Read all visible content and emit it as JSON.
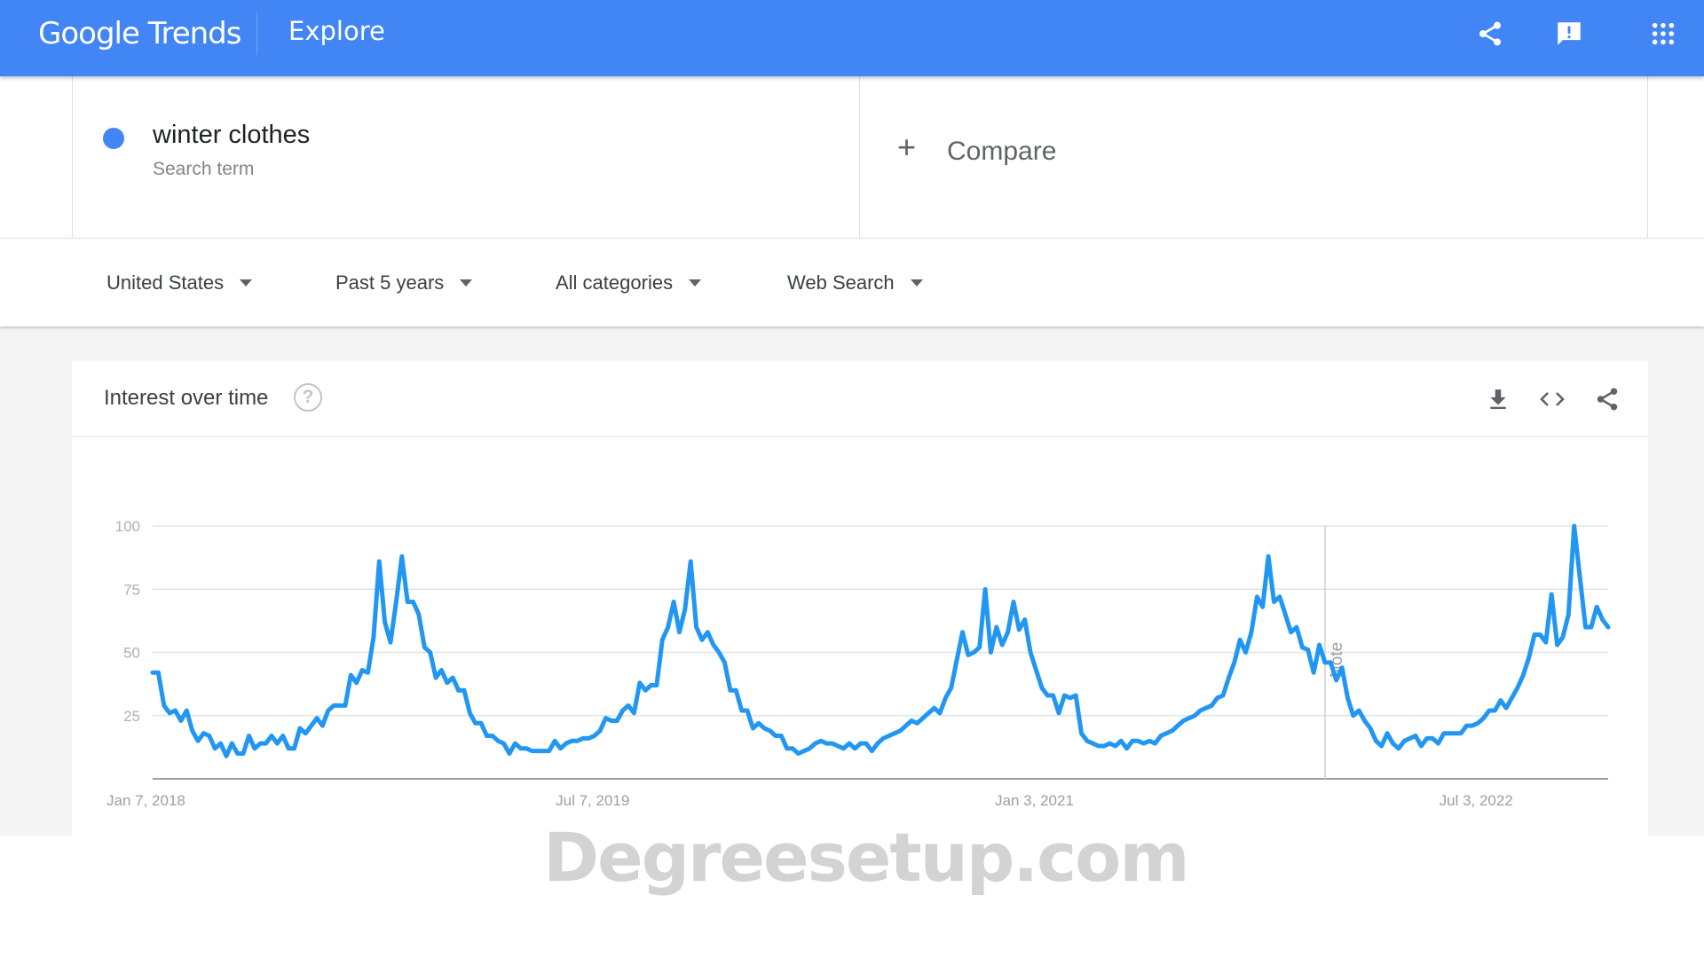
{
  "header": {
    "logo": "Google Trends",
    "section": "Explore",
    "icons": [
      "share-icon",
      "feedback-icon",
      "apps-grid-icon"
    ],
    "brand_color": "#4285f4"
  },
  "search_term": {
    "name": "winter clothes",
    "type_label": "Search term",
    "color": "#4285f4"
  },
  "compare": {
    "icon": "plus-icon",
    "label": "Compare"
  },
  "filters": [
    {
      "label": "United States"
    },
    {
      "label": "Past 5 years"
    },
    {
      "label": "All categories"
    },
    {
      "label": "Web Search"
    }
  ],
  "card": {
    "title": "Interest over time",
    "help_icon": "?",
    "icons": [
      "download-icon",
      "embed-code-icon",
      "share-icon"
    ]
  },
  "watermark": "Degreesetup.com",
  "chart_data": {
    "type": "line",
    "title": "Interest over time",
    "series": [
      {
        "name": "winter clothes",
        "color": "#2196f3",
        "values": [
          42,
          42,
          29,
          26,
          27,
          23,
          27,
          19,
          15,
          18,
          17,
          12,
          14,
          9,
          14,
          10,
          10,
          17,
          12,
          14,
          14,
          17,
          14,
          17,
          12,
          12,
          20,
          18,
          21,
          24,
          21,
          27,
          29,
          29,
          29,
          41,
          38,
          43,
          42,
          56,
          86,
          62,
          54,
          70,
          88,
          70,
          70,
          65,
          52,
          50,
          40,
          43,
          38,
          40,
          35,
          35,
          26,
          22,
          22,
          17,
          17,
          15,
          14,
          10,
          14,
          12,
          12,
          11,
          11,
          11,
          11,
          15,
          12,
          14,
          15,
          15,
          16,
          16,
          17,
          19,
          24,
          23,
          23,
          27,
          29,
          26,
          38,
          35,
          37,
          37,
          55,
          60,
          70,
          58,
          67,
          86,
          60,
          55,
          58,
          53,
          50,
          46,
          35,
          35,
          27,
          27,
          20,
          22,
          20,
          19,
          17,
          17,
          12,
          12,
          10,
          11,
          12,
          14,
          15,
          14,
          14,
          13,
          12,
          14,
          12,
          14,
          14,
          11,
          14,
          16,
          17,
          18,
          19,
          21,
          23,
          22,
          24,
          26,
          28,
          26,
          32,
          36,
          47,
          58,
          49,
          50,
          52,
          75,
          50,
          60,
          53,
          58,
          70,
          59,
          63,
          50,
          43,
          36,
          33,
          33,
          26,
          33,
          32,
          33,
          18,
          15,
          14,
          13,
          13,
          14,
          13,
          15,
          12,
          15,
          15,
          14,
          15,
          14,
          17,
          18,
          19,
          21,
          23,
          24,
          25,
          27,
          28,
          29,
          32,
          33,
          40,
          46,
          55,
          50,
          58,
          72,
          68,
          88,
          70,
          72,
          65,
          58,
          60,
          52,
          51,
          42,
          53,
          46,
          46,
          39,
          44,
          32,
          25,
          27,
          23,
          20,
          15,
          13,
          18,
          14,
          12,
          15,
          16,
          17,
          13,
          16,
          16,
          14,
          18,
          18,
          18,
          18,
          21,
          21,
          22,
          24,
          27,
          27,
          31,
          28,
          32,
          36,
          41,
          48,
          57,
          57,
          54,
          73,
          53,
          56,
          65,
          100,
          80,
          60,
          60,
          68,
          63,
          60
        ]
      }
    ],
    "x_tick_labels": [
      "Jan 7, 2018",
      "Jul 7, 2019",
      "Jan 3, 2021",
      "Jul 3, 2022"
    ],
    "x_tick_indices": [
      0,
      78,
      156,
      234
    ],
    "y_ticks": [
      25,
      50,
      75,
      100
    ],
    "ylim": [
      0,
      100
    ],
    "xlabel": "",
    "ylabel": "",
    "grid": true,
    "annotation": {
      "label": "Note",
      "at_index": 207
    }
  }
}
